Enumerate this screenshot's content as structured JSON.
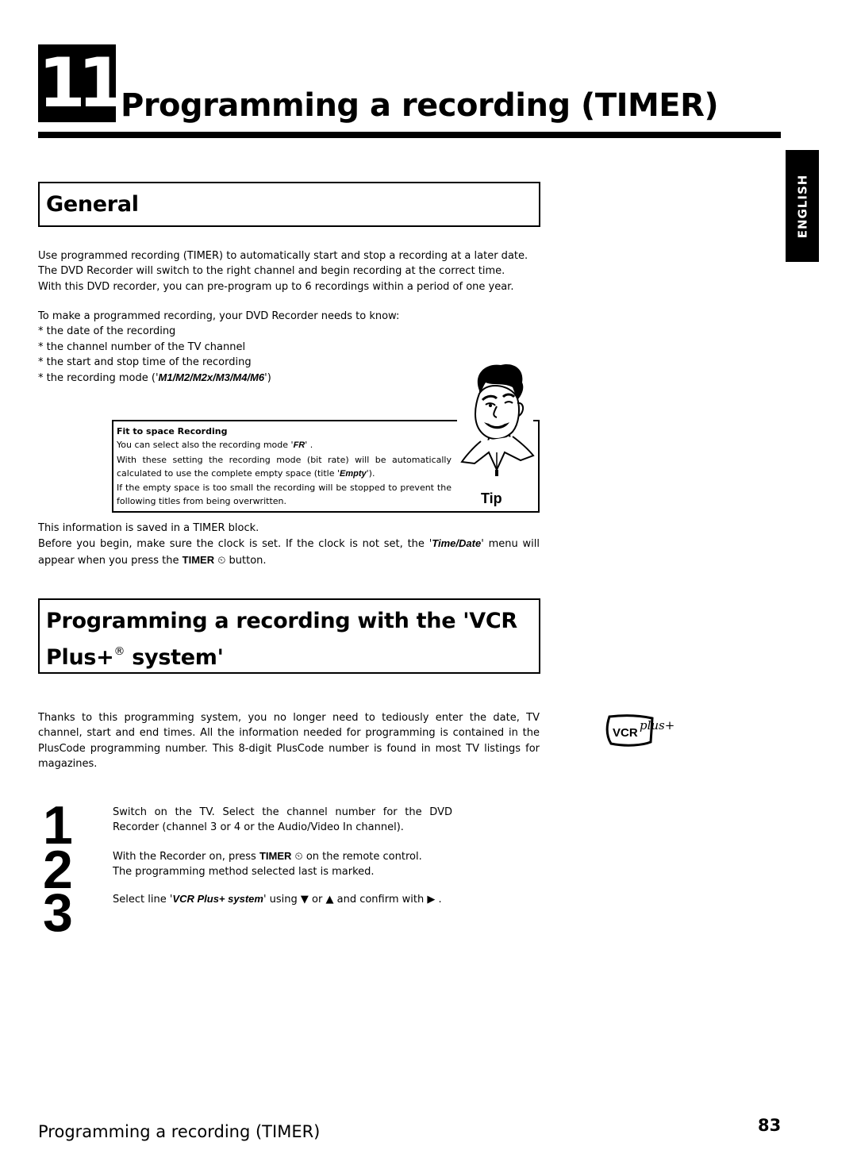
{
  "chapter": {
    "number": "11",
    "title": "Programming a recording (TIMER)"
  },
  "language_tab": "ENGLISH",
  "general": {
    "heading": "General",
    "intro_lines": [
      "Use programmed recording (TIMER) to automatically start and stop a recording at a later date.",
      "The DVD Recorder will switch to the right channel and begin recording at the correct time.",
      "With this DVD recorder, you can pre-program up to 6 recordings within a period of one year."
    ],
    "needs_intro": "To make a programmed recording, your DVD Recorder needs to know:",
    "bullet_marker": "*",
    "needs": [
      "the date of the recording",
      "the channel number of the TV channel",
      "the start and stop time of the recording"
    ],
    "mode_item": {
      "prefix": "the recording mode ('",
      "modes": "M1/M2/M2x/M3/M4/M6",
      "suffix": "')"
    },
    "tip": {
      "label": "Tip",
      "heading": "Fit to space Recording",
      "line1_prefix": "You can select also the recording mode '",
      "line1_mode": "FR",
      "line1_suffix": "' .",
      "line2": "With these setting the recording mode (bit rate) will be automatically calculated to use the complete empty space (title '",
      "line2_title": "Empty",
      "line2_suffix": "').",
      "line3": "If the empty space is too small the recording will be stopped to prevent the following titles from being overwritten."
    },
    "saved_note": "This information is saved in a TIMER block.",
    "clock_note_prefix": "Before you begin, make sure the clock is set. If the clock is not set, the '",
    "clock_note_menu": "Time/Date",
    "clock_note_mid": "' menu will appear when you press the ",
    "clock_note_button": "TIMER",
    "clock_icon": "⏲",
    "clock_note_suffix": " button."
  },
  "vcr_plus": {
    "heading_line1": "Programming a recording with the 'VCR",
    "heading_plus": "Plus+",
    "heading_reg": "®",
    "heading_end": " system'",
    "intro": "Thanks to this programming system, you no longer need to tediously enter the date, TV channel, start and end times. All the information needed for programming is contained in the PlusCode programming number. This 8-digit PlusCode number is found in most TV listings for magazines.",
    "logo_text": "VCR",
    "logo_script": "plus+",
    "steps": [
      {
        "number": "1",
        "text": "Switch on the TV. Select the channel number for the DVD Recorder (channel 3 or 4 or the Audio/Video In channel)."
      },
      {
        "number": "2",
        "prefix": "With the Recorder on, press ",
        "button": "TIMER",
        "icon": "⏲",
        "suffix": " on the remote control.",
        "line2": "The programming method selected last is marked."
      },
      {
        "number": "3",
        "prefix": "Select line '",
        "item": "VCR Plus+ system",
        "mid": "' using ",
        "down": "▼",
        "or": " or ",
        "up": "▲",
        "confirm": " and confirm with ",
        "right": "▶",
        "end": " ."
      }
    ]
  },
  "footer": {
    "title": "Programming a recording (TIMER)",
    "page": "83"
  }
}
